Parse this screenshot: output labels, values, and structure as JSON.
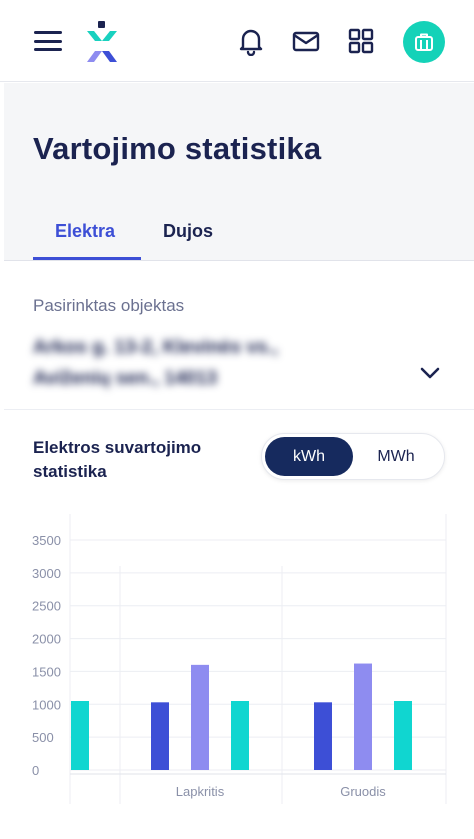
{
  "header": {
    "icons": [
      "menu-icon",
      "logo-icon",
      "bell-icon",
      "mail-icon",
      "grid-icon",
      "briefcase-icon"
    ]
  },
  "page": {
    "title": "Vartojimo statistika"
  },
  "tabs": [
    {
      "label": "Elektra",
      "active": true
    },
    {
      "label": "Dujos",
      "active": false
    }
  ],
  "object": {
    "label": "Pasirinktas objektas",
    "address": "Arkos g. 13-2, Klevinės vs., Aviženių sen., 14013"
  },
  "stats": {
    "title": "Elektros suvartojimo statistika",
    "units": [
      {
        "label": "kWh",
        "active": true
      },
      {
        "label": "MWh",
        "active": false
      }
    ]
  },
  "colors": {
    "accent": "#3d4fd6",
    "navy": "#1b2350",
    "teal": "#14d2b8",
    "bar_blue": "#3d4fd6",
    "bar_purple": "#8e8cf0",
    "bar_teal": "#10d6d0"
  },
  "chart_data": {
    "type": "bar",
    "ylim": [
      0,
      3500
    ],
    "yticks": [
      0,
      500,
      1000,
      1500,
      2000,
      2500,
      3000,
      3500
    ],
    "categories": [
      "",
      "Lapkritis",
      "Gruodis"
    ],
    "groups": [
      {
        "category": "",
        "bars": [
          {
            "color": "teal",
            "value": 1050
          }
        ]
      },
      {
        "category": "Lapkritis",
        "bars": [
          {
            "color": "blue",
            "value": 1030
          },
          {
            "color": "purple",
            "value": 1600
          },
          {
            "color": "teal",
            "value": 1050
          }
        ]
      },
      {
        "category": "Gruodis",
        "bars": [
          {
            "color": "blue",
            "value": 1030
          },
          {
            "color": "purple",
            "value": 1620
          },
          {
            "color": "teal",
            "value": 1050
          }
        ]
      }
    ]
  }
}
